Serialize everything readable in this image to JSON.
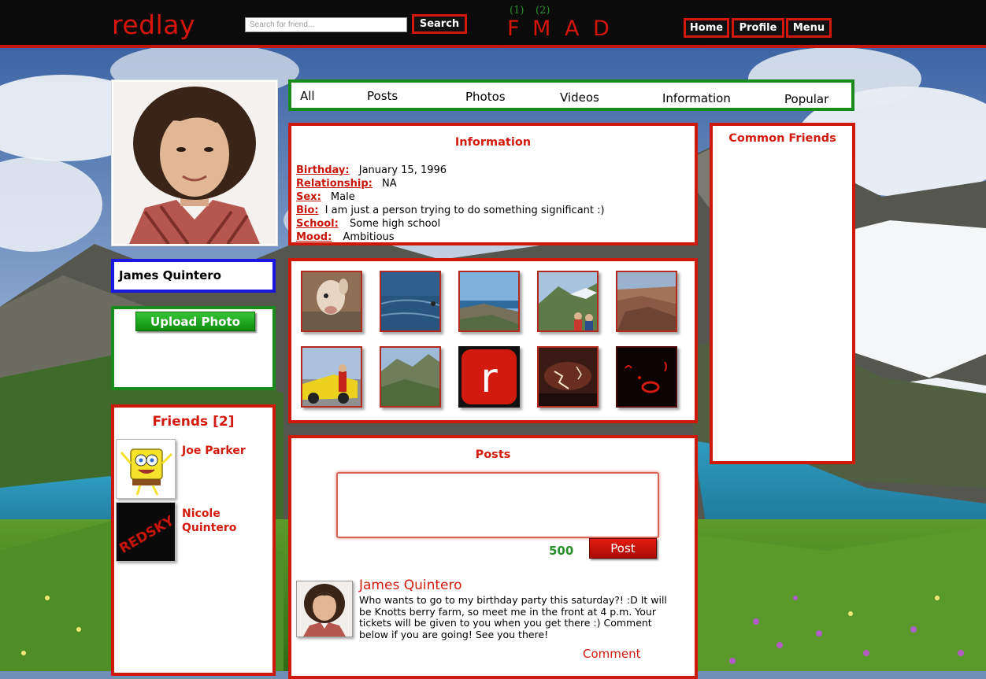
{
  "header": {
    "logo": "redlay",
    "search_placeholder": "Search for friend...",
    "search_button": "Search",
    "notifications": [
      {
        "letter": "F",
        "count": ""
      },
      {
        "letter": "M",
        "count": "(1)"
      },
      {
        "letter": "A",
        "count": "(2)"
      },
      {
        "letter": "D",
        "count": ""
      }
    ],
    "nav": {
      "home": "Home",
      "profile": "Profile",
      "menu": "Menu"
    }
  },
  "sidebar": {
    "name": "James Quintero",
    "upload_button": "Upload Photo",
    "friends_title": "Friends [2]",
    "friends": [
      {
        "name": "Joe Parker"
      },
      {
        "name": "Nicole Quintero"
      }
    ]
  },
  "tabs": [
    "All",
    "Posts",
    "Photos",
    "Videos",
    "Information",
    "Popular"
  ],
  "information": {
    "title": "Information",
    "rows": [
      {
        "label": "Birthday:",
        "value": "January 15, 1996"
      },
      {
        "label": "Relationship:",
        "value": "NA"
      },
      {
        "label": "Sex:",
        "value": "Male"
      },
      {
        "label": "Bio:",
        "value": "I am just a person trying to do something significant :)"
      },
      {
        "label": "School:",
        "value": "Some high school"
      },
      {
        "label": "Mood:",
        "value": "Ambitious"
      }
    ]
  },
  "photos": {
    "r_logo_text": "r",
    "redsky_text": "REDSKY"
  },
  "common_friends": {
    "title": "Common Friends"
  },
  "posts": {
    "title": "Posts",
    "char_count": "500",
    "post_button": "Post",
    "items": [
      {
        "author": "James Quintero",
        "text": "Who wants to go to my birthday party this saturday?! :D It will be Knotts berry farm, so meet me in the front at 4 p.m. Your tickets will be given to you when you get there :) Comment below if you are going! See you there!",
        "comment_label": "Comment"
      }
    ]
  },
  "colors": {
    "brand_red": "#d21b0e",
    "accent_green": "#198b1a",
    "accent_blue": "#1c16e2"
  }
}
